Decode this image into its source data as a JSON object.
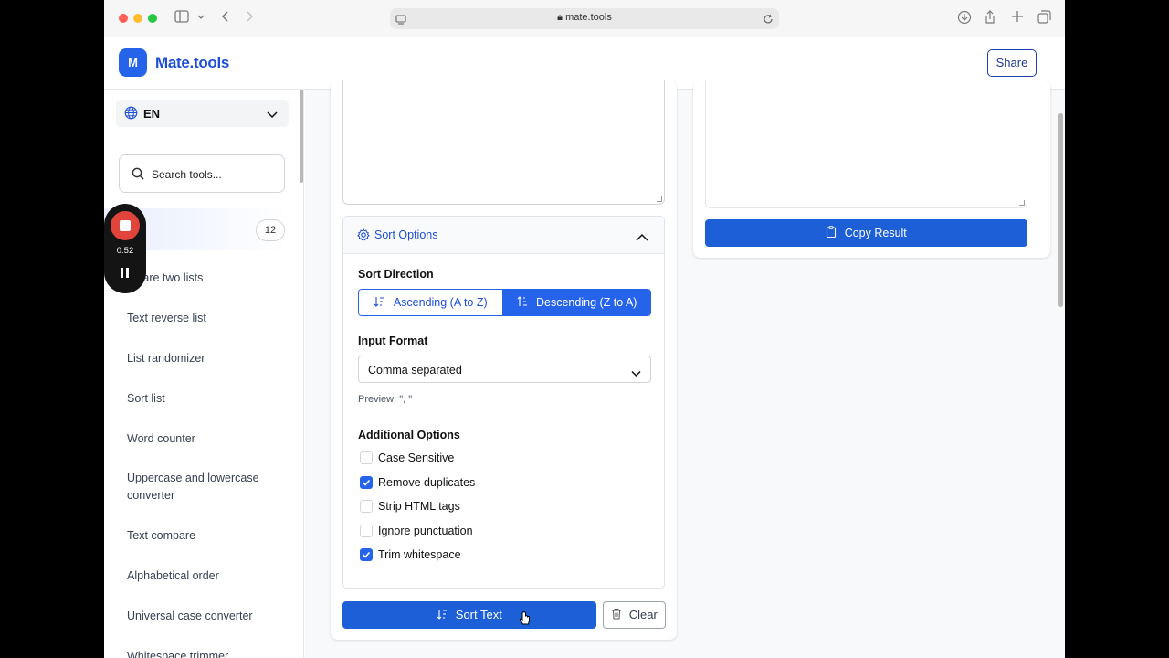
{
  "browser": {
    "url": "mate.tools"
  },
  "header": {
    "logo_letter": "M",
    "brand": "Mate.tools",
    "share_label": "Share"
  },
  "sidebar": {
    "language": "EN",
    "search_placeholder": "Search tools...",
    "active_count": "12",
    "items": [
      "mpare two lists",
      "Text reverse list",
      "List randomizer",
      "Sort list",
      "Word counter",
      "Uppercase and lowercase converter",
      "Text compare",
      "Alphabetical order",
      "Universal case converter",
      "Whitespace trimmer"
    ]
  },
  "recorder": {
    "time": "0:52"
  },
  "sort_options": {
    "title": "Sort Options",
    "direction_label": "Sort Direction",
    "ascending_label": "Ascending (A to Z)",
    "descending_label": "Descending (Z to A)",
    "selected_direction": "descending",
    "input_format_label": "Input Format",
    "input_format_value": "Comma separated",
    "preview": "Preview: \", \"",
    "additional_label": "Additional Options",
    "options": [
      {
        "label": "Case Sensitive",
        "checked": false
      },
      {
        "label": "Remove duplicates",
        "checked": true
      },
      {
        "label": "Strip HTML tags",
        "checked": false
      },
      {
        "label": "Ignore punctuation",
        "checked": false
      },
      {
        "label": "Trim whitespace",
        "checked": true
      }
    ]
  },
  "actions": {
    "sort_label": "Sort Text",
    "clear_label": "Clear",
    "copy_label": "Copy Result"
  },
  "colors": {
    "accent": "#2563eb",
    "recorder_stop": "#e0443b"
  }
}
